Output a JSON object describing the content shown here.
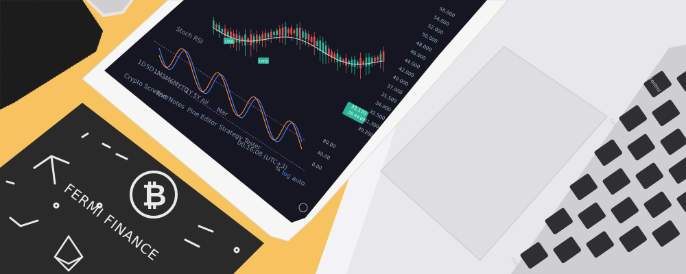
{
  "colors": {
    "desk": "#f7c35f",
    "tablet_frame": "#f4f4f4",
    "tablet_screen": "#141722",
    "candle_up": "#2bb59a",
    "candle_down": "#e94c4c",
    "card": "#2a2a2a",
    "laptop": "#e9e9ec",
    "wallet": "#1e1e1e",
    "key": "#2f2f33"
  },
  "card": {
    "brand": "FERMI FINANCE"
  },
  "tablet": {
    "indicator_label": "Stoch RSI",
    "timeframes": [
      "1D",
      "5D",
      "1M",
      "3M",
      "6M",
      "YTD",
      "1Y",
      "5Y",
      "All"
    ],
    "bottom_tabs": [
      "Crypto Screener",
      "Text Notes",
      "Pine Editor",
      "Strategy Tester"
    ],
    "clock": "00:16:08 (UTC+3)",
    "scale_controls": [
      "%",
      "log",
      "auto"
    ],
    "month_label": "Mar",
    "signal_labels": [
      "Long",
      "Long"
    ],
    "price_axis": [
      "56.000",
      "54.000",
      "52.000",
      "50.000",
      "48.000",
      "46.000",
      "44.000",
      "42.000",
      "40.000",
      "37.000",
      "35.500",
      "34.000",
      "32.500",
      "31.300",
      "30.200"
    ],
    "current_price": "33.170",
    "countdown": "05:44:09",
    "indicator_axis": [
      "80.00",
      "40.00",
      "0.00"
    ]
  },
  "laptop": {
    "keys": [
      "control",
      "option",
      "command",
      "command"
    ]
  }
}
